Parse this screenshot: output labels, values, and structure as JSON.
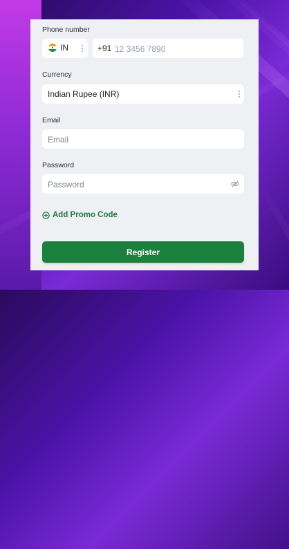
{
  "form": {
    "phone": {
      "label": "Phone number",
      "country_code": "IN",
      "prefix": "+91",
      "placeholder": "12 3456 7890",
      "value": ""
    },
    "currency": {
      "label": "Currency",
      "selected": "Indian Rupee (INR)"
    },
    "email": {
      "label": "Email",
      "placeholder": "Email",
      "value": ""
    },
    "password": {
      "label": "Password",
      "placeholder": "Password",
      "value": ""
    },
    "promo_link": "Add Promo Code",
    "submit_label": "Register"
  },
  "icons": {
    "country_flag": "india-flag-icon",
    "country_menu": "kebab-menu-icon",
    "currency_menu": "kebab-menu-icon",
    "password_toggle": "eye-slash-icon",
    "promo": "plus-circle-icon"
  },
  "colors": {
    "accent_green": "#1b7f3d",
    "panel_bg": "#eef0f4",
    "background_purple": "#4b13a8"
  }
}
